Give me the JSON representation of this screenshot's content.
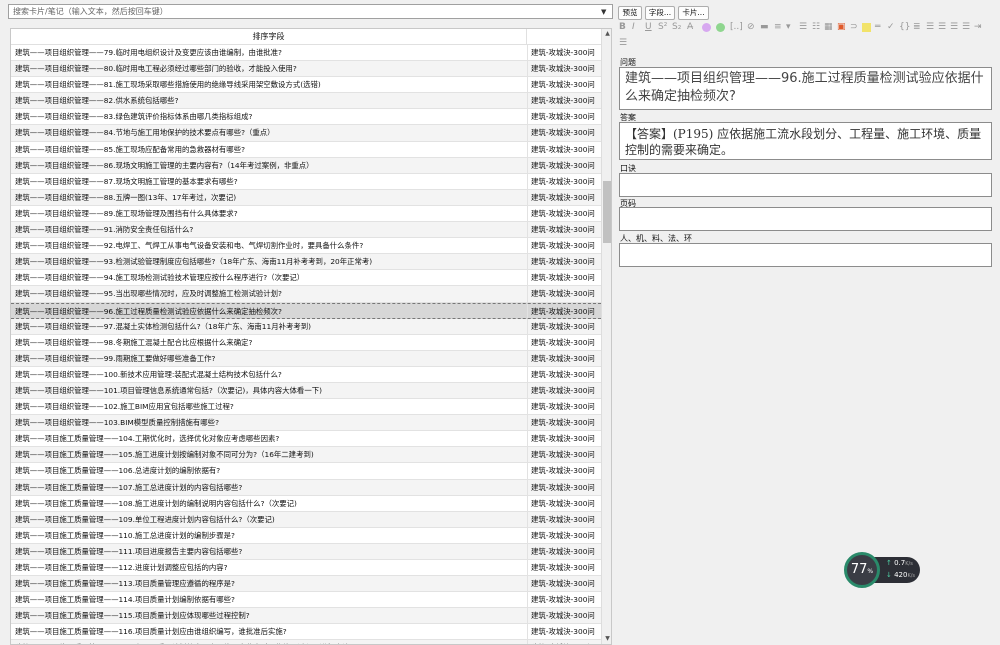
{
  "search": {
    "placeholder": "搜索卡片/笔记（输入文本，然后按回车键）"
  },
  "table": {
    "header": "排序字段",
    "rows": [
      [
        "建筑——项目组织管理——79.临时用电组织设计及变更应该由谁编制，由谁批准?",
        "建筑-攻城決-300问"
      ],
      [
        "建筑——项目组织管理——80.临时用电工程必须经过哪些部门的验收，才能投入使用?",
        "建筑-攻城決-300问"
      ],
      [
        "建筑——项目组织管理——81.施工现场采取哪些措施使用的绝缘导线采用架空敷设方式(选错)",
        "建筑-攻城決-300问"
      ],
      [
        "建筑——项目组织管理——82.供水系统包括哪些?",
        "建筑-攻城決-300问"
      ],
      [
        "建筑——项目组织管理——83.绿色建筑评价指标体系由哪几类指标组成?",
        "建筑-攻城決-300问"
      ],
      [
        "建筑——项目组织管理——84.节地与施工用地保护的技术要点有哪些?（重点）",
        "建筑-攻城決-300问"
      ],
      [
        "建筑——项目组织管理——85.施工现场应配备常用的急救器材有哪些?",
        "建筑-攻城決-300问"
      ],
      [
        "建筑——项目组织管理——86.现场文明施工管理的主要内容有?（14年考过案例，非重点）",
        "建筑-攻城決-300问"
      ],
      [
        "建筑——项目组织管理——87.现场文明施工管理的基本要求有哪些?",
        "建筑-攻城決-300问"
      ],
      [
        "建筑——项目组织管理——88.五牌一图(13年、17年考过，次要记)",
        "建筑-攻城決-300问"
      ],
      [
        "建筑——项目组织管理——89.施工现场管理及围挡有什么具体要求?",
        "建筑-攻城決-300问"
      ],
      [
        "建筑——项目组织管理——91.消防安全责任包括什么?",
        "建筑-攻城決-300问"
      ],
      [
        "建筑——项目组织管理——92.电焊工、气焊工从事电气设备安装和电、气焊切割作业时，要具备什么条件?",
        "建筑-攻城決-300问"
      ],
      [
        "建筑——项目组织管理——93.检测试验管理制度应包括哪些?（18年广东、海南11月补考考到，20年正常考)",
        "建筑-攻城決-300问"
      ],
      [
        "建筑——项目组织管理——94.施工现场检测试验技术管理应按什么程序进行?（次要记）",
        "建筑-攻城決-300问"
      ],
      [
        "建筑——项目组织管理——95.当出现哪些情况时，应及时调整施工检测试验计划?",
        "建筑-攻城決-300问"
      ],
      [
        "建筑——项目组织管理——96.施工过程质量检测试验应依据什么来确定抽检频次?",
        "建筑-攻城決-300问"
      ],
      [
        "建筑——项目组织管理——97.混凝土实体检测包括什么?（18年广东、海南11月补考考到)",
        "建筑-攻城決-300问"
      ],
      [
        "建筑——项目组织管理——98.冬期施工混凝土配合比应根据什么来确定?",
        "建筑-攻城決-300问"
      ],
      [
        "建筑——项目组织管理——99.雨期施工要做好哪些准备工作?",
        "建筑-攻城決-300问"
      ],
      [
        "建筑——项目组织管理——100.新技术应用管理:装配式混凝土结构技术包括什么?",
        "建筑-攻城決-300问"
      ],
      [
        "建筑——项目组织管理——101.项目管理信息系统通常包括?（次要记)，具体内容大体看一下)",
        "建筑-攻城決-300问"
      ],
      [
        "建筑——项目组织管理——102.施工BIM应用宜包括哪些施工过程?",
        "建筑-攻城決-300问"
      ],
      [
        "建筑——项目组织管理——103.BIM模型质量控制措施有哪些?",
        "建筑-攻城決-300问"
      ],
      [
        "建筑——项目施工质量管理——104.工期优化时，选择优化对象应考虑哪些因素?",
        "建筑-攻城決-300问"
      ],
      [
        "建筑——项目施工质量管理——105.施工进度计划按编制对象不同可分为?（16年二建考到)",
        "建筑-攻城決-300问"
      ],
      [
        "建筑——项目施工质量管理——106.总进度计划的编制依据有?",
        "建筑-攻城決-300问"
      ],
      [
        "建筑——项目施工质量管理——107.施工总进度计划的内容包括哪些?",
        "建筑-攻城決-300问"
      ],
      [
        "建筑——项目施工质量管理——108.施工进度计划的编制说明内容包括什么?（次要记)",
        "建筑-攻城決-300问"
      ],
      [
        "建筑——项目施工质量管理——109.单位工程进度计划内容包括什么?（次要记)",
        "建筑-攻城決-300问"
      ],
      [
        "建筑——项目施工质量管理——110.施工总进度计划的编制步骤是?",
        "建筑-攻城決-300问"
      ],
      [
        "建筑——项目施工质量管理——111.项目进度报告主要内容包括哪些?",
        "建筑-攻城決-300问"
      ],
      [
        "建筑——项目施工质量管理——112.进度计划调整应包括的内容?",
        "建筑-攻城決-300问"
      ],
      [
        "建筑——项目施工质量管理——113.项目质量管理应遵循的程序是?",
        "建筑-攻城決-300问"
      ],
      [
        "建筑——项目施工质量管理——114.项目质量计划编制依据有哪些?",
        "建筑-攻城決-300问"
      ],
      [
        "建筑——项目施工质量管理——115.项目质量计划应体现哪些过程控制?",
        "建筑-攻城決-300问"
      ],
      [
        "建筑——项目施工质量管理——116.项目质量计划应由谁组织编写，谁批准后实施?",
        "建筑-攻城決-300问"
      ],
      [
        "建筑——项目施工质量管理——117.在项目质量计划的应用中，施工企业应对哪些施工过程要进行确认?",
        "建筑-攻城決-300问"
      ]
    ],
    "selected_index": 16
  },
  "toolbar": {
    "preview": "预览",
    "fields": "字段...",
    "cards": "卡片..."
  },
  "editor": {
    "fields": [
      {
        "label": "问题",
        "value": "建筑——项目组织管理——96.施工过程质量检测试验应依据什么来确定抽检频次?"
      },
      {
        "label": "答案",
        "value": "【答案】(P195) 应依据施工流水段划分、工程量、施工环境、质量控制的需要来确定。"
      },
      {
        "label": "口诀",
        "value": ""
      },
      {
        "label": "页码",
        "value": ""
      },
      {
        "label": "人、机、料、法、环",
        "value": ""
      }
    ]
  },
  "widget": {
    "percent": "77",
    "percent_unit": "%",
    "up": "0.7",
    "up_unit": "K/s",
    "down": "420",
    "down_unit": "K/s"
  },
  "colors": {
    "selected_row": "#d7d7d7",
    "alt_row": "#f4f4f4",
    "widget_ring": "#2a8a6a"
  }
}
